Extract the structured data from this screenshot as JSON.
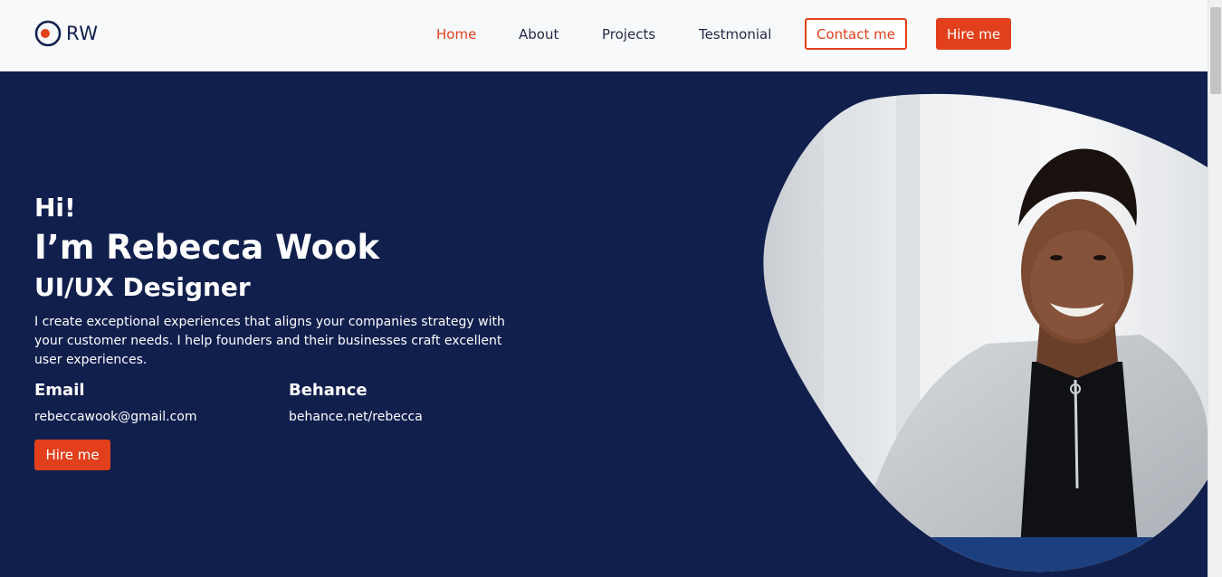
{
  "brand": {
    "logo_text": "RW"
  },
  "nav": {
    "home": "Home",
    "about": "About",
    "projects": "Projects",
    "testimonial": "Testmonial",
    "contact_button": "Contact me",
    "hire_button": "Hire me"
  },
  "hero": {
    "greeting": "Hi!",
    "name": "I’m Rebecca Wook",
    "role": "UI/UX Designer",
    "description": "I create exceptional experiences that aligns your companies strategy with your customer needs. I help founders and their businesses craft excellent user experiences.",
    "email_label": "Email",
    "email_value": "rebeccawook@gmail.com",
    "behance_label": "Behance",
    "behance_value": "behance.net/rebecca",
    "hire_button": "Hire me"
  },
  "colors": {
    "accent": "#e2401c",
    "navy": "#111f4d",
    "header_bg": "#f8f9fb"
  }
}
